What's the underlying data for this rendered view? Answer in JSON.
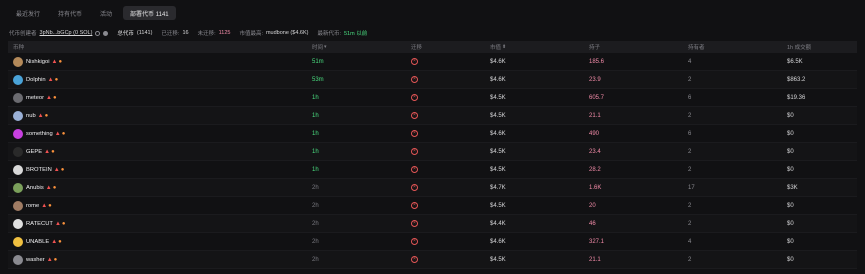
{
  "tabs": [
    {
      "label": "最近发行",
      "active": false
    },
    {
      "label": "持有代币",
      "active": false
    },
    {
      "label": "活动",
      "active": false
    },
    {
      "label": "部署代币 1141",
      "active": true
    }
  ],
  "info": {
    "creator_label": "代币创建者",
    "creator_value": "3pNb...bGCp (0 SOL)",
    "total_label": "总代币",
    "total_value": "(1141)",
    "migrated_label": "已迁移:",
    "migrated_value": "16",
    "unmigrated_label": "未迁移:",
    "unmigrated_value": "1125",
    "top_label": "市值最高:",
    "top_value": "mudbone ($4.6K)",
    "latest_label": "最新代币:",
    "latest_value": "51m 以前"
  },
  "columns": {
    "name": "币种",
    "time": "时间",
    "migrated": "迁移",
    "mcap": "市值",
    "holders": "持子",
    "identity": "持有者",
    "volume": "1h 成交额"
  },
  "rows": [
    {
      "name": "Nishkigoi",
      "time": "51m",
      "fresh": true,
      "mcap": "$4.6K",
      "holders": "185.6",
      "identity": "4",
      "volume": "$6.5K",
      "color": "#b48a5a"
    },
    {
      "name": "Dolphin",
      "time": "53m",
      "fresh": true,
      "mcap": "$4.6K",
      "holders": "23.9",
      "identity": "2",
      "volume": "$863.2",
      "color": "#4aa3d8"
    },
    {
      "name": "meteor",
      "time": "1h",
      "fresh": true,
      "mcap": "$4.5K",
      "holders": "605.7",
      "identity": "6",
      "volume": "$19.36",
      "color": "#6b6b70"
    },
    {
      "name": "nub",
      "time": "1h",
      "fresh": true,
      "mcap": "$4.5K",
      "holders": "21.1",
      "identity": "2",
      "volume": "$0",
      "color": "#9ab0d6"
    },
    {
      "name": "something",
      "time": "1h",
      "fresh": true,
      "mcap": "$4.6K",
      "holders": "490",
      "identity": "6",
      "volume": "$0",
      "color": "#c840e0"
    },
    {
      "name": "GEPE",
      "time": "1h",
      "fresh": true,
      "mcap": "$4.5K",
      "holders": "23.4",
      "identity": "2",
      "volume": "$0",
      "color": "#2a2a2a"
    },
    {
      "name": "BROTEIN",
      "time": "1h",
      "fresh": true,
      "mcap": "$4.5K",
      "holders": "28.2",
      "identity": "2",
      "volume": "$0",
      "color": "#d9d9d9"
    },
    {
      "name": "Anubis",
      "time": "2h",
      "fresh": false,
      "mcap": "$4.7K",
      "holders": "1.6K",
      "identity": "17",
      "volume": "$3K",
      "color": "#7ba05b"
    },
    {
      "name": "rome",
      "time": "2h",
      "fresh": false,
      "mcap": "$4.5K",
      "holders": "20",
      "identity": "2",
      "volume": "$0",
      "color": "#a07c64"
    },
    {
      "name": "RATECUT",
      "time": "2h",
      "fresh": false,
      "mcap": "$4.4K",
      "holders": "46",
      "identity": "2",
      "volume": "$0",
      "color": "#e0e0e0"
    },
    {
      "name": "UNABLE",
      "time": "2h",
      "fresh": false,
      "mcap": "$4.6K",
      "holders": "327.1",
      "identity": "4",
      "volume": "$0",
      "color": "#f0c040"
    },
    {
      "name": "washer",
      "time": "2h",
      "fresh": false,
      "mcap": "$4.5K",
      "holders": "21.1",
      "identity": "2",
      "volume": "$0",
      "color": "#8a8a90"
    }
  ]
}
